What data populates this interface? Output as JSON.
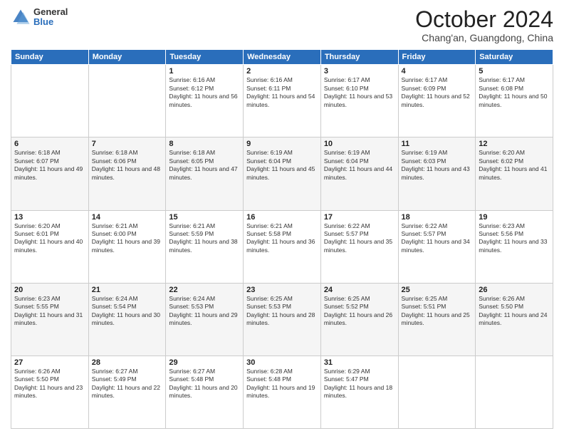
{
  "header": {
    "logo_general": "General",
    "logo_blue": "Blue",
    "month_title": "October 2024",
    "location": "Chang'an, Guangdong, China"
  },
  "days_of_week": [
    "Sunday",
    "Monday",
    "Tuesday",
    "Wednesday",
    "Thursday",
    "Friday",
    "Saturday"
  ],
  "weeks": [
    [
      {
        "day": "",
        "info": ""
      },
      {
        "day": "",
        "info": ""
      },
      {
        "day": "1",
        "info": "Sunrise: 6:16 AM\nSunset: 6:12 PM\nDaylight: 11 hours and 56 minutes."
      },
      {
        "day": "2",
        "info": "Sunrise: 6:16 AM\nSunset: 6:11 PM\nDaylight: 11 hours and 54 minutes."
      },
      {
        "day": "3",
        "info": "Sunrise: 6:17 AM\nSunset: 6:10 PM\nDaylight: 11 hours and 53 minutes."
      },
      {
        "day": "4",
        "info": "Sunrise: 6:17 AM\nSunset: 6:09 PM\nDaylight: 11 hours and 52 minutes."
      },
      {
        "day": "5",
        "info": "Sunrise: 6:17 AM\nSunset: 6:08 PM\nDaylight: 11 hours and 50 minutes."
      }
    ],
    [
      {
        "day": "6",
        "info": "Sunrise: 6:18 AM\nSunset: 6:07 PM\nDaylight: 11 hours and 49 minutes."
      },
      {
        "day": "7",
        "info": "Sunrise: 6:18 AM\nSunset: 6:06 PM\nDaylight: 11 hours and 48 minutes."
      },
      {
        "day": "8",
        "info": "Sunrise: 6:18 AM\nSunset: 6:05 PM\nDaylight: 11 hours and 47 minutes."
      },
      {
        "day": "9",
        "info": "Sunrise: 6:19 AM\nSunset: 6:04 PM\nDaylight: 11 hours and 45 minutes."
      },
      {
        "day": "10",
        "info": "Sunrise: 6:19 AM\nSunset: 6:04 PM\nDaylight: 11 hours and 44 minutes."
      },
      {
        "day": "11",
        "info": "Sunrise: 6:19 AM\nSunset: 6:03 PM\nDaylight: 11 hours and 43 minutes."
      },
      {
        "day": "12",
        "info": "Sunrise: 6:20 AM\nSunset: 6:02 PM\nDaylight: 11 hours and 41 minutes."
      }
    ],
    [
      {
        "day": "13",
        "info": "Sunrise: 6:20 AM\nSunset: 6:01 PM\nDaylight: 11 hours and 40 minutes."
      },
      {
        "day": "14",
        "info": "Sunrise: 6:21 AM\nSunset: 6:00 PM\nDaylight: 11 hours and 39 minutes."
      },
      {
        "day": "15",
        "info": "Sunrise: 6:21 AM\nSunset: 5:59 PM\nDaylight: 11 hours and 38 minutes."
      },
      {
        "day": "16",
        "info": "Sunrise: 6:21 AM\nSunset: 5:58 PM\nDaylight: 11 hours and 36 minutes."
      },
      {
        "day": "17",
        "info": "Sunrise: 6:22 AM\nSunset: 5:57 PM\nDaylight: 11 hours and 35 minutes."
      },
      {
        "day": "18",
        "info": "Sunrise: 6:22 AM\nSunset: 5:57 PM\nDaylight: 11 hours and 34 minutes."
      },
      {
        "day": "19",
        "info": "Sunrise: 6:23 AM\nSunset: 5:56 PM\nDaylight: 11 hours and 33 minutes."
      }
    ],
    [
      {
        "day": "20",
        "info": "Sunrise: 6:23 AM\nSunset: 5:55 PM\nDaylight: 11 hours and 31 minutes."
      },
      {
        "day": "21",
        "info": "Sunrise: 6:24 AM\nSunset: 5:54 PM\nDaylight: 11 hours and 30 minutes."
      },
      {
        "day": "22",
        "info": "Sunrise: 6:24 AM\nSunset: 5:53 PM\nDaylight: 11 hours and 29 minutes."
      },
      {
        "day": "23",
        "info": "Sunrise: 6:25 AM\nSunset: 5:53 PM\nDaylight: 11 hours and 28 minutes."
      },
      {
        "day": "24",
        "info": "Sunrise: 6:25 AM\nSunset: 5:52 PM\nDaylight: 11 hours and 26 minutes."
      },
      {
        "day": "25",
        "info": "Sunrise: 6:25 AM\nSunset: 5:51 PM\nDaylight: 11 hours and 25 minutes."
      },
      {
        "day": "26",
        "info": "Sunrise: 6:26 AM\nSunset: 5:50 PM\nDaylight: 11 hours and 24 minutes."
      }
    ],
    [
      {
        "day": "27",
        "info": "Sunrise: 6:26 AM\nSunset: 5:50 PM\nDaylight: 11 hours and 23 minutes."
      },
      {
        "day": "28",
        "info": "Sunrise: 6:27 AM\nSunset: 5:49 PM\nDaylight: 11 hours and 22 minutes."
      },
      {
        "day": "29",
        "info": "Sunrise: 6:27 AM\nSunset: 5:48 PM\nDaylight: 11 hours and 20 minutes."
      },
      {
        "day": "30",
        "info": "Sunrise: 6:28 AM\nSunset: 5:48 PM\nDaylight: 11 hours and 19 minutes."
      },
      {
        "day": "31",
        "info": "Sunrise: 6:29 AM\nSunset: 5:47 PM\nDaylight: 11 hours and 18 minutes."
      },
      {
        "day": "",
        "info": ""
      },
      {
        "day": "",
        "info": ""
      }
    ]
  ]
}
